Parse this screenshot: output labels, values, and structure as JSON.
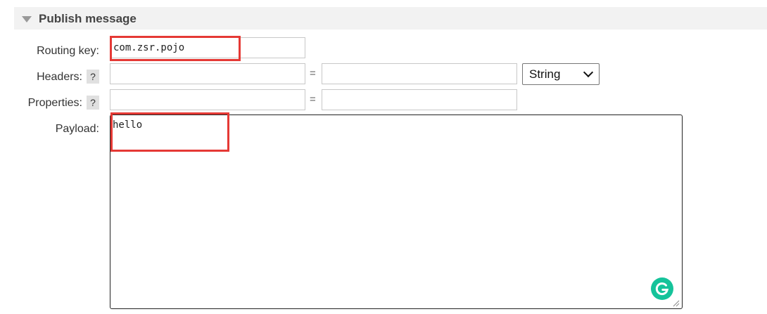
{
  "section": {
    "title": "Publish message"
  },
  "routing_key": {
    "label": "Routing key:",
    "value": "com.zsr.pojo"
  },
  "headers": {
    "label": "Headers:",
    "help": "?",
    "key_value": "",
    "equals": "=",
    "value": "",
    "type_select": "String"
  },
  "properties": {
    "label": "Properties:",
    "help": "?",
    "key_value": "",
    "equals": "=",
    "value": ""
  },
  "payload": {
    "label": "Payload:",
    "value": "hello"
  },
  "colors": {
    "highlight": "#e53935",
    "grammarly": "#15c39a",
    "header_bg": "#f2f2f2"
  },
  "icons": [
    "collapse-triangle-icon",
    "grammarly-icon",
    "resize-handle-icon",
    "chevron-down-icon"
  ]
}
